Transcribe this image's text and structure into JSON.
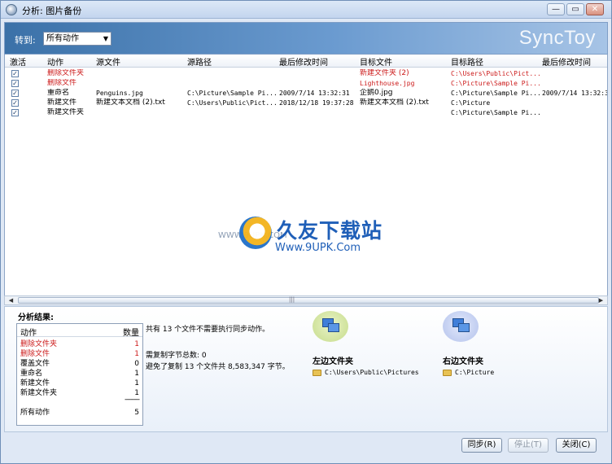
{
  "window": {
    "title": "分析: 图片备份",
    "min_label": "—",
    "max_label": "▭",
    "close_label": "✕"
  },
  "header": {
    "goto_label": "转到:",
    "goto_value": "所有动作",
    "brand": "SyncToy"
  },
  "table": {
    "columns": [
      "激活",
      "动作",
      "源文件",
      "源路径",
      "最后修改时间",
      "目标文件",
      "目标路径",
      "最后修改时间"
    ],
    "rows": [
      {
        "active": "✓",
        "action": "删除文件夹",
        "src_file": "",
        "src_path": "",
        "src_time": "",
        "dst_file": "新建文件夹 (2)",
        "dst_path": "C:\\Users\\Public\\Pict...",
        "dst_time": "",
        "red": true
      },
      {
        "active": "✓",
        "action": "删除文件",
        "src_file": "",
        "src_path": "",
        "src_time": "",
        "dst_file": "Lighthouse.jpg",
        "dst_path": "C:\\Picture\\Sample Pi...",
        "dst_time": "",
        "red": true
      },
      {
        "active": "✓",
        "action": "重命名",
        "src_file": "Penguins.jpg",
        "src_path": "C:\\Picture\\Sample Pi...",
        "src_time": "2009/7/14 13:32:31",
        "dst_file": "企鹅0.jpg",
        "dst_path": "C:\\Picture\\Sample Pi...",
        "dst_time": "2009/7/14 13:32:3",
        "red": false
      },
      {
        "active": "✓",
        "action": "新建文件",
        "src_file": "新建文本文档 (2).txt",
        "src_path": "C:\\Users\\Public\\Pict...",
        "src_time": "2018/12/18 19:37:28",
        "dst_file": "新建文本文档 (2).txt",
        "dst_path": "C:\\Picture",
        "dst_time": "",
        "red": false
      },
      {
        "active": "✓",
        "action": "新建文件夹",
        "src_file": "",
        "src_path": "",
        "src_time": "",
        "dst_file": "",
        "dst_path": "C:\\Picture\\Sample Pi...",
        "dst_time": "",
        "red": false
      }
    ]
  },
  "watermark": {
    "title": "久友下载站",
    "url": "Www.9UPK.Com",
    "small": "WWW.9UPK.COM"
  },
  "results": {
    "title": "分析结果:",
    "col_action": "动作",
    "col_count": "数量",
    "items": [
      {
        "name": "删除文件夹",
        "count": "1",
        "red": true
      },
      {
        "name": "删除文件",
        "count": "1",
        "red": true
      },
      {
        "name": "覆盖文件",
        "count": "0",
        "red": false
      },
      {
        "name": "重命名",
        "count": "1",
        "red": false
      },
      {
        "name": "新建文件",
        "count": "1",
        "red": false
      },
      {
        "name": "新建文件夹",
        "count": "1",
        "red": false
      }
    ],
    "dashes": "--------",
    "total_label": "所有动作",
    "total_count": "5",
    "line1": "共有 13 个文件不需要执行同步动作。",
    "line2": "需复制字节总数: 0",
    "line3": "避免了复制 13 个文件共 8,583,347 字节。",
    "left_title": "左边文件夹",
    "left_path": "C:\\Users\\Public\\Pictures",
    "right_title": "右边文件夹",
    "right_path": "C:\\Picture"
  },
  "buttons": {
    "sync": "同步(R)",
    "stop": "停止(T)",
    "close": "关闭(C)"
  }
}
